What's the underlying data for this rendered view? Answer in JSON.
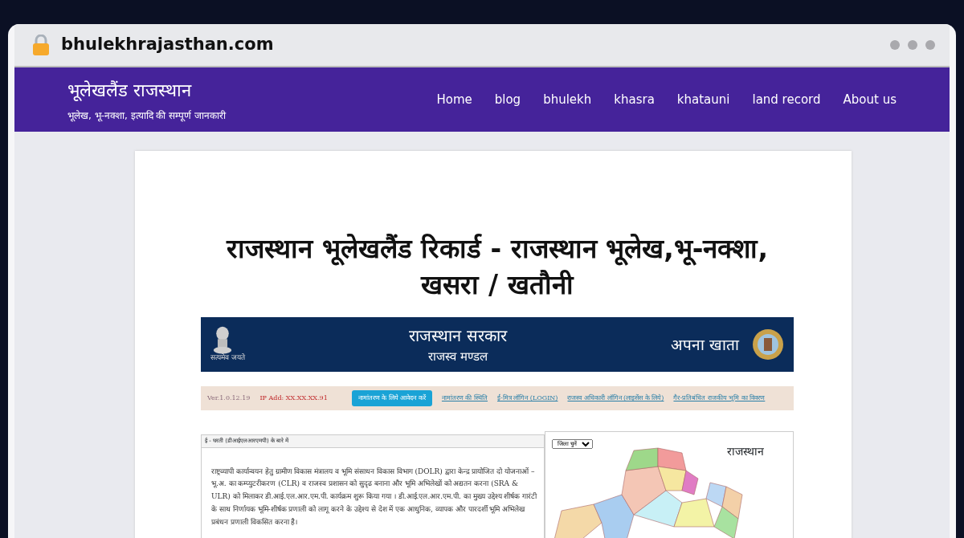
{
  "browser": {
    "url": "bhulekhrajasthan.com",
    "secure": true
  },
  "site": {
    "title": "भूलेखलैंड राजस्थान",
    "tagline": "भूलेख, भू-नक्शा, इत्यादि की सम्पूर्ण जानकारी",
    "nav": [
      {
        "label": "Home"
      },
      {
        "label": "blog"
      },
      {
        "label": "bhulekh"
      },
      {
        "label": "khasra"
      },
      {
        "label": "khatauni"
      },
      {
        "label": "land record"
      },
      {
        "label": "About us"
      }
    ]
  },
  "article": {
    "title": "राजस्थान भूलेखलैंड रिकार्ड - राजस्थान भूलेख,भू-नक्शा, खसरा / खतौनी",
    "screenshot": {
      "emblem_motto": "सत्यमेव जयते",
      "header_title": "राजस्थान सरकार",
      "header_subtitle": "राजस्व मण्डल",
      "header_right": "अपना खाता",
      "version": "Ver.1.0.12.19",
      "ip": "IP Add: XX.XX.XX.91",
      "links": [
        {
          "label": "नामांतरण के लिये आवेदन करें",
          "kind": "button"
        },
        {
          "label": "नामांतरण की स्थिति",
          "kind": "link"
        },
        {
          "label": "ई-मित्र लॉगिन (LOGIN)",
          "kind": "link"
        },
        {
          "label": "राजस्व अधिकारी लॉगिन (लाइसेंस के लिये)",
          "kind": "link"
        },
        {
          "label": "गैर-प्रतिबंधित राजकीय भूमि का विवरण",
          "kind": "link"
        }
      ],
      "panel_title": "ई - धरती (डीआईएलआरएमपी) के बारे में",
      "panel_text": "राष्ट्रव्यापी कार्यान्वयन हेतु ग्रामीण विकास मंत्रालय व भूमि संसाधन विकास विभाग (DOLR) द्वारा केन्द्र प्रायोजित दो योजनाओं – भू.अ. का कम्प्युटरीकरण (CLR) व राजस्व प्रशासन को सुदृढ बनाना और भूमि अभिलेखों को अद्यतन करना (SRA & ULR) को मिलाकर डी.आई.एल.आर.एम.पी. कार्यक्रम शुरू किया गया । डी.आई.एल.आर.एम.पी. का मुख्य उद्देश्य शीर्षक गारंटी के साथ निर्णायक भूमि-शीर्षक प्रणाली को लागू करने के उद्देश्य से देश में एक आधुनिक, व्यापक और पारदर्शी भूमि अभिलेख प्रबंधन प्रणाली विकसित करना है।",
      "district_select": "जिला चुनें",
      "map_title": "राजस्थान"
    }
  }
}
